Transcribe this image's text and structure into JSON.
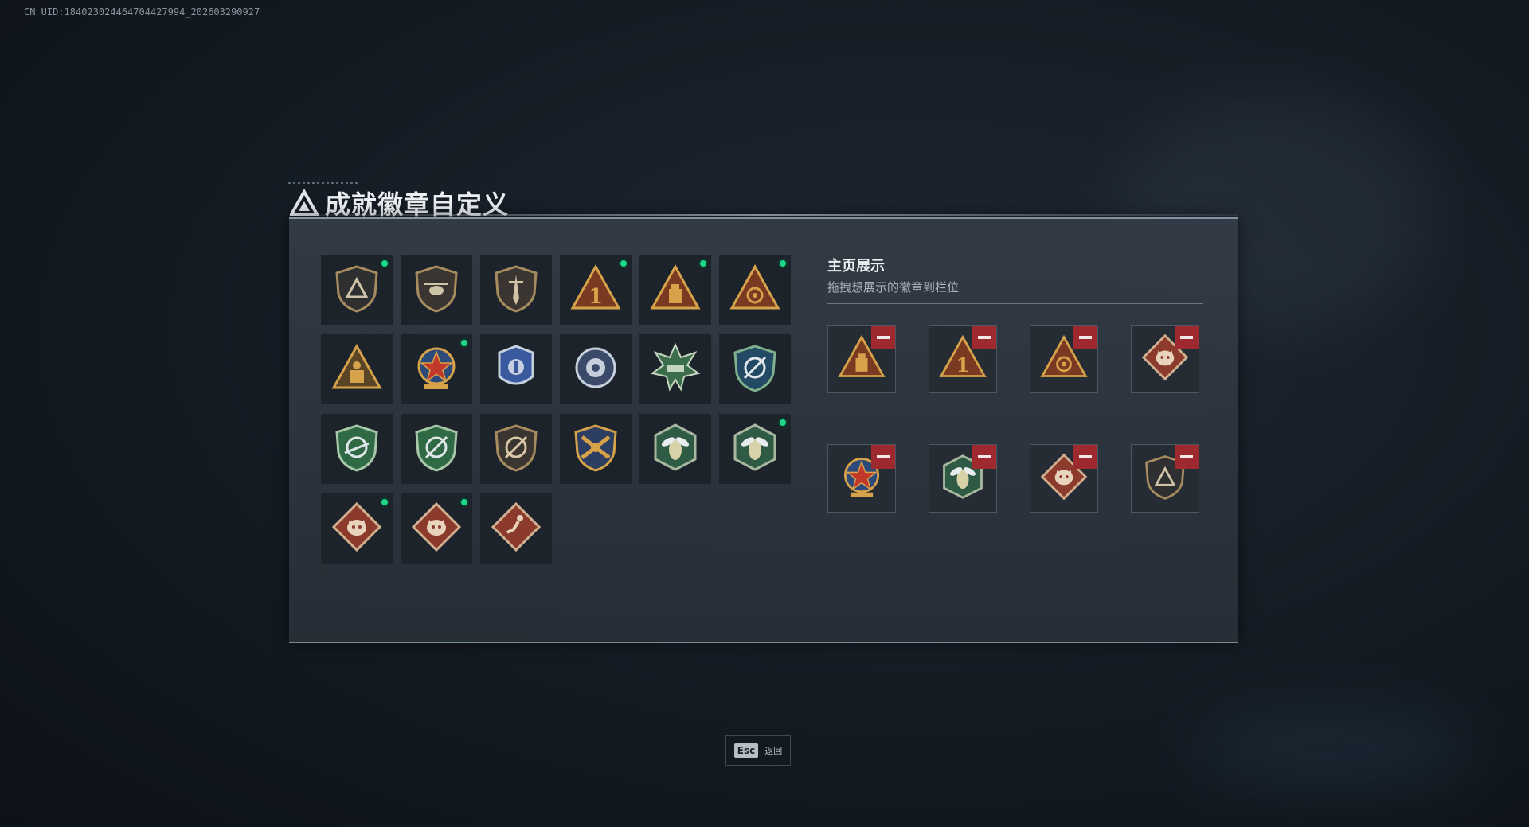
{
  "uid": "CN UID:184023024464704427994_202603290927",
  "title": "成就徽章自定义",
  "showcase": {
    "title": "主页展示",
    "subtitle": "拖拽想展示的徽章到栏位"
  },
  "badges": [
    {
      "icon": "bronze-shield-triangle-icon",
      "new": true
    },
    {
      "icon": "bronze-helicopter-shield-icon",
      "new": false
    },
    {
      "icon": "bronze-dagger-shield-icon",
      "new": false
    },
    {
      "icon": "gold-triangle-number-one-icon",
      "new": true
    },
    {
      "icon": "gold-triangle-crate-icon",
      "new": true
    },
    {
      "icon": "gold-triangle-wreath-icon",
      "new": true
    },
    {
      "icon": "gold-triangle-soldiers-icon",
      "new": false
    },
    {
      "icon": "red-star-medal-icon",
      "new": true
    },
    {
      "icon": "blue-police-badge-icon",
      "new": false
    },
    {
      "icon": "silver-flower-badge-icon",
      "new": false
    },
    {
      "icon": "green-tank-burst-icon",
      "new": false
    },
    {
      "icon": "green-blue-crosshair-shield-icon",
      "new": false
    },
    {
      "icon": "green-rifle-crosshair-shield-icon",
      "new": false
    },
    {
      "icon": "green-crosshair-shield-icon",
      "new": false
    },
    {
      "icon": "bronze-crosshair-shield-icon",
      "new": false
    },
    {
      "icon": "gold-crossed-weapons-icon",
      "new": false
    },
    {
      "icon": "green-hornet-hexagon-icon",
      "new": false
    },
    {
      "icon": "green-hornet-hexagon-icon",
      "new": true
    },
    {
      "icon": "red-dragon-diamond-icon",
      "new": true
    },
    {
      "icon": "red-dragon-diamond-icon",
      "new": true
    },
    {
      "icon": "red-runner-diamond-icon",
      "new": false
    }
  ],
  "slots": [
    {
      "icon": "gold-triangle-crate-icon"
    },
    {
      "icon": "gold-triangle-number-one-icon"
    },
    {
      "icon": "gold-triangle-wreath-icon"
    },
    {
      "icon": "red-dragon-diamond-icon"
    },
    {
      "icon": "red-star-medal-icon"
    },
    {
      "icon": "green-hornet-hexagon-icon"
    },
    {
      "icon": "red-dragon-diamond-icon"
    },
    {
      "icon": "bronze-shield-triangle-icon"
    }
  ],
  "esc": {
    "key": "Esc",
    "label": "返回"
  },
  "colors": {
    "new_dot": "#1fd68b",
    "remove": "#9e2a2f",
    "panel_border": "#8393a3"
  }
}
